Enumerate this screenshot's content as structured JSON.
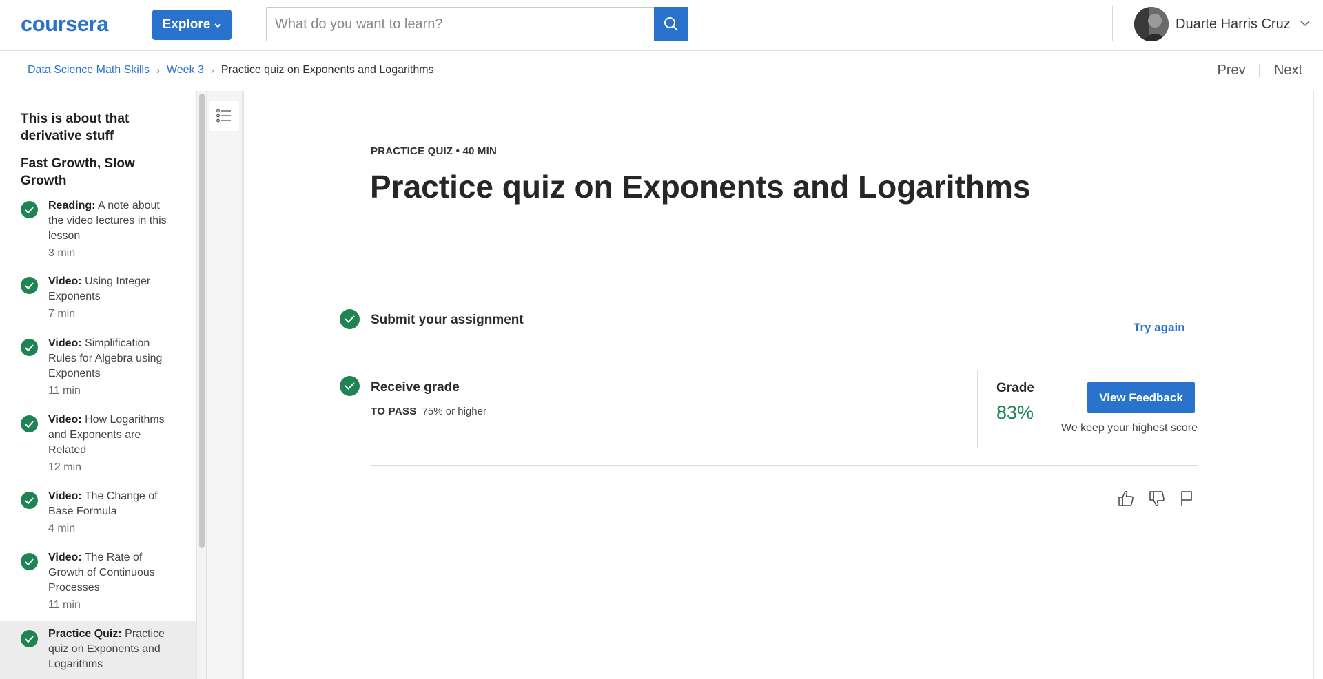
{
  "header": {
    "logo": "coursera",
    "explore_label": "Explore",
    "search_placeholder": "What do you want to learn?",
    "user_name": "Duarte Harris Cruz"
  },
  "breadcrumb": {
    "items": [
      "Data Science Math Skills",
      "Week 3"
    ],
    "current": "Practice quiz on Exponents and Logarithms",
    "prev": "Prev",
    "next": "Next"
  },
  "sidebar": {
    "heading1": "This is about that derivative stuff",
    "heading2": "Fast Growth, Slow Growth",
    "items": [
      {
        "type": "Reading:",
        "title": "A note about the video lectures in this lesson",
        "duration": "3 min"
      },
      {
        "type": "Video:",
        "title": "Using Integer Exponents",
        "duration": "7 min"
      },
      {
        "type": "Video:",
        "title": "Simplification Rules for Algebra using Exponents",
        "duration": "11 min"
      },
      {
        "type": "Video:",
        "title": "How Logarithms and Exponents are Related",
        "duration": "12 min"
      },
      {
        "type": "Video:",
        "title": "The Change of Base Formula",
        "duration": "4 min"
      },
      {
        "type": "Video:",
        "title": "The Rate of Growth of Continuous Processes",
        "duration": "11 min"
      },
      {
        "type": "Practice Quiz:",
        "title": "Practice quiz on Exponents and Logarithms",
        "duration": ""
      }
    ]
  },
  "main": {
    "meta": "PRACTICE QUIZ • 40 MIN",
    "title": "Practice quiz on Exponents and Logarithms",
    "submit_title": "Submit your assignment",
    "try_again": "Try again",
    "receive_title": "Receive grade",
    "to_pass_label": "TO PASS",
    "to_pass_value": "75% or higher",
    "grade_label": "Grade",
    "grade_value": "83%",
    "feedback_button": "View Feedback",
    "highest_note": "We keep your highest score"
  },
  "colors": {
    "brand_blue": "#2a73cc",
    "success_green": "#1f8354"
  },
  "icons": [
    "search-icon",
    "chevron-down-icon",
    "check-icon",
    "list-icon",
    "thumbs-up-icon",
    "thumbs-down-icon",
    "flag-icon"
  ]
}
